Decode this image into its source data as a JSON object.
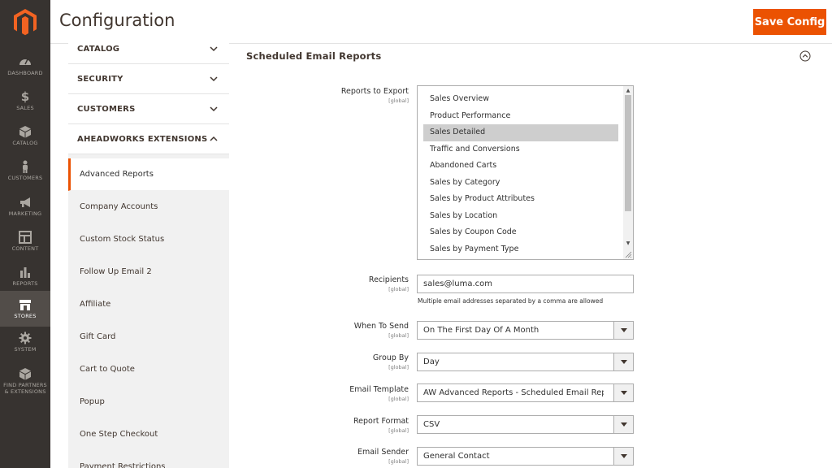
{
  "page": {
    "title": "Configuration",
    "save_label": "Save Config"
  },
  "admin_menu": {
    "items": [
      {
        "label": "DASHBOARD",
        "icon": "dashboard-icon"
      },
      {
        "label": "SALES",
        "icon": "dollar-icon"
      },
      {
        "label": "CATALOG",
        "icon": "box-icon"
      },
      {
        "label": "CUSTOMERS",
        "icon": "person-icon"
      },
      {
        "label": "MARKETING",
        "icon": "megaphone-icon"
      },
      {
        "label": "CONTENT",
        "icon": "layout-icon"
      },
      {
        "label": "REPORTS",
        "icon": "bar-chart-icon"
      },
      {
        "label": "STORES",
        "icon": "store-icon",
        "active": true
      },
      {
        "label": "SYSTEM",
        "icon": "gear-icon"
      },
      {
        "label": "FIND PARTNERS",
        "label2": "& EXTENSIONS",
        "icon": "cube-icon"
      }
    ]
  },
  "config_tabs": {
    "groups": [
      {
        "label": "CATALOG",
        "expanded": false
      },
      {
        "label": "SECURITY",
        "expanded": false
      },
      {
        "label": "CUSTOMERS",
        "expanded": false
      },
      {
        "label": "AHEADWORKS EXTENSIONS",
        "expanded": true
      }
    ],
    "items": [
      {
        "label": "Advanced Reports",
        "current": true
      },
      {
        "label": "Company Accounts"
      },
      {
        "label": "Custom Stock Status"
      },
      {
        "label": "Follow Up Email 2"
      },
      {
        "label": "Affiliate"
      },
      {
        "label": "Gift Card"
      },
      {
        "label": "Cart to Quote"
      },
      {
        "label": "Popup"
      },
      {
        "label": "One Step Checkout"
      },
      {
        "label": "Payment Restrictions"
      }
    ]
  },
  "section": {
    "title": "Scheduled Email Reports",
    "scope_label": "[global]",
    "fields": {
      "reports_to_export": {
        "label": "Reports to Export",
        "options": [
          "Sales Overview",
          "Product Performance",
          "Sales Detailed",
          "Traffic and Conversions",
          "Abandoned Carts",
          "Sales by Category",
          "Sales by Product Attributes",
          "Sales by Location",
          "Sales by Coupon Code",
          "Sales by Payment Type"
        ],
        "selected": "Sales Detailed"
      },
      "recipients": {
        "label": "Recipients",
        "value": "sales@luma.com",
        "note": "Multiple email addresses separated by a comma are allowed"
      },
      "when_to_send": {
        "label": "When To Send",
        "value": "On The First Day Of A Month"
      },
      "group_by": {
        "label": "Group By",
        "value": "Day"
      },
      "email_template": {
        "label": "Email Template",
        "value": "AW Advanced Reports - Scheduled Email Report (Default)"
      },
      "report_format": {
        "label": "Report Format",
        "value": "CSV"
      },
      "email_sender": {
        "label": "Email Sender",
        "value": "General Contact"
      }
    }
  },
  "colors": {
    "accent": "#eb5202",
    "menu_bg": "#373330",
    "menu_active": "#524d49"
  }
}
